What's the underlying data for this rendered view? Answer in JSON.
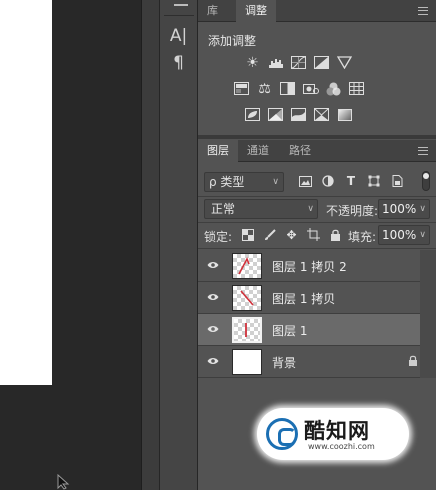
{
  "tool_column": {
    "icons": [
      "character-icon",
      "paragraph-icon"
    ],
    "glyphs": [
      "A|",
      "¶"
    ]
  },
  "adjustments_panel": {
    "tabs": [
      {
        "label": "库",
        "active": false
      },
      {
        "label": "调整",
        "active": true
      }
    ],
    "title": "添加调整",
    "rows": [
      [
        "brightness-contrast-icon",
        "levels-icon",
        "curves-icon",
        "exposure-icon",
        "vibrance-icon"
      ],
      [
        "hue-saturation-icon",
        "color-balance-icon",
        "black-white-icon",
        "photo-filter-icon",
        "channel-mixer-icon",
        "color-lookup-icon"
      ],
      [
        "invert-icon",
        "posterize-icon",
        "threshold-icon",
        "selective-color-icon",
        "gradient-map-icon"
      ]
    ]
  },
  "layers_panel": {
    "tabs": [
      {
        "label": "图层",
        "active": true
      },
      {
        "label": "通道",
        "active": false
      },
      {
        "label": "路径",
        "active": false
      }
    ],
    "filter_label": "ρ 类型",
    "filter_icons": [
      "pixel-filter-icon",
      "adjustment-filter-icon",
      "type-filter-icon",
      "shape-filter-icon",
      "smart-object-filter-icon"
    ],
    "blend_mode": "正常",
    "opacity_label": "不透明度:",
    "opacity_value": "100%",
    "lock_label": "锁定:",
    "fill_label": "填充:",
    "fill_value": "100%",
    "layers": [
      {
        "name": "图层 1 拷贝 2",
        "visible": true,
        "selected": false,
        "thumb": "transparent-stroke-angled"
      },
      {
        "name": "图层 1 拷贝",
        "visible": true,
        "selected": false,
        "thumb": "transparent-stroke-diagonal"
      },
      {
        "name": "图层 1",
        "visible": true,
        "selected": true,
        "thumb": "transparent-stroke-vertical"
      },
      {
        "name": "背景",
        "visible": true,
        "selected": false,
        "thumb": "white",
        "locked": true
      }
    ]
  },
  "watermark": {
    "name": "酷知网",
    "url": "www.coozhi.com"
  },
  "colors": {
    "stroke_red": "#d0303a",
    "selected_row": "#6a6a6a",
    "panel_bg": "#535353"
  }
}
